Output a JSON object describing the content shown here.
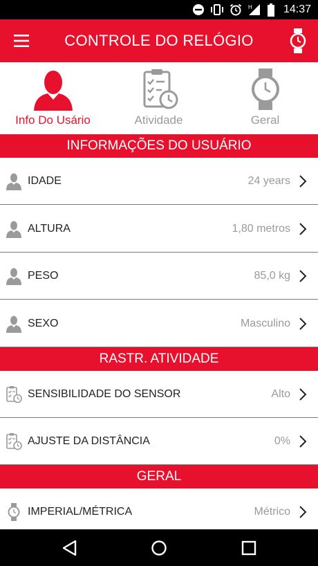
{
  "status_bar": {
    "time": "14:37",
    "icons": [
      "do-not-disturb-icon",
      "vibrate-icon",
      "alarm-icon",
      "signal-icon",
      "battery-icon"
    ]
  },
  "app_bar": {
    "title": "CONTROLE DO RELÓGIO",
    "menu_icon": "hamburger-menu-icon",
    "action_icon": "watch-icon"
  },
  "tabs": [
    {
      "label": "Info Do Usário",
      "icon": "user-icon",
      "active": true
    },
    {
      "label": "Atividade",
      "icon": "clipboard-clock-icon",
      "active": false
    },
    {
      "label": "Geral",
      "icon": "watch-icon",
      "active": false
    }
  ],
  "sections": {
    "user_info": {
      "title": "INFORMAÇÕES DO USUÁRIO",
      "rows": [
        {
          "label": "IDADE",
          "value": "24 years",
          "icon": "user-icon"
        },
        {
          "label": "ALTURA",
          "value": "1,80 metros",
          "icon": "user-icon"
        },
        {
          "label": "PESO",
          "value": "85,0 kg",
          "icon": "user-icon"
        },
        {
          "label": "SEXO",
          "value": "Masculino",
          "icon": "user-icon"
        }
      ]
    },
    "activity": {
      "title": "RASTR. ATIVIDADE",
      "rows": [
        {
          "label": "SENSIBILIDADE DO SENSOR",
          "value": "Alto",
          "icon": "clipboard-clock-icon"
        },
        {
          "label": "AJUSTE DA DISTÂNCIA",
          "value": "0%",
          "icon": "clipboard-clock-icon"
        }
      ]
    },
    "general": {
      "title": "GERAL",
      "rows": [
        {
          "label": "IMPERIAL/MÉTRICA",
          "value": "Métrico",
          "icon": "watch-icon"
        }
      ]
    }
  },
  "colors": {
    "accent": "#e8112d",
    "inactive": "#9a9a9a",
    "text": "#222222",
    "divider": "#7a7a7a"
  }
}
